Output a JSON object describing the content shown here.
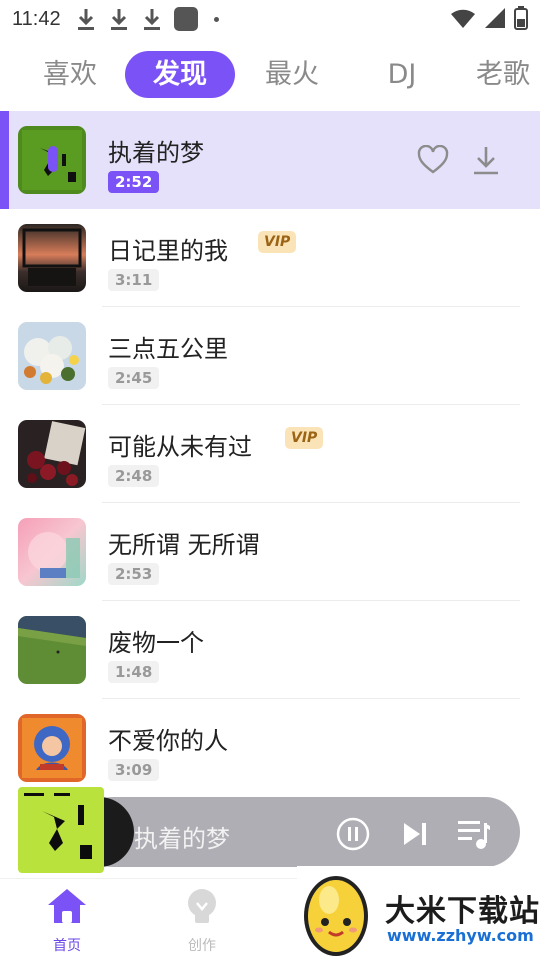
{
  "status_bar": {
    "time": "11:42"
  },
  "tabs": [
    {
      "label": "喜欢",
      "active": false
    },
    {
      "label": "发现",
      "active": true
    },
    {
      "label": "最火",
      "active": false
    },
    {
      "label": "DJ",
      "active": false
    },
    {
      "label": "老歌",
      "active": false
    }
  ],
  "songs": [
    {
      "title": "执着的梦",
      "duration": "2:52",
      "vip": false,
      "playing": true
    },
    {
      "title": "日记里的我",
      "duration": "3:11",
      "vip": true,
      "vip_label": "VIP"
    },
    {
      "title": "三点五公里",
      "duration": "2:45",
      "vip": false
    },
    {
      "title": "可能从未有过",
      "duration": "2:48",
      "vip": true,
      "vip_label": "VIP"
    },
    {
      "title": "无所谓 无所谓",
      "duration": "2:53",
      "vip": false
    },
    {
      "title": "废物一个",
      "duration": "1:48",
      "vip": false
    },
    {
      "title": "不爱你的人",
      "duration": "3:09",
      "vip": false
    }
  ],
  "player": {
    "title": "执着的梦"
  },
  "bottom_nav": [
    {
      "label": "首页",
      "icon": "home-icon",
      "active": true
    },
    {
      "label": "创作",
      "icon": "lightbulb-icon",
      "active": false
    }
  ],
  "watermark": {
    "name": "大米下载站",
    "url": "www.zzhyw.com"
  },
  "colors": {
    "accent": "#7b52f5",
    "active_row": "#e6e1fb",
    "vip_bg": "#fbe3b8",
    "player_pill": "#aeaeb4"
  },
  "icons": [
    "download-icon",
    "app-square-icon",
    "wifi-icon",
    "signal-icon",
    "battery-icon",
    "heart-icon",
    "pause-icon",
    "skip-next-icon",
    "playlist-icon"
  ]
}
